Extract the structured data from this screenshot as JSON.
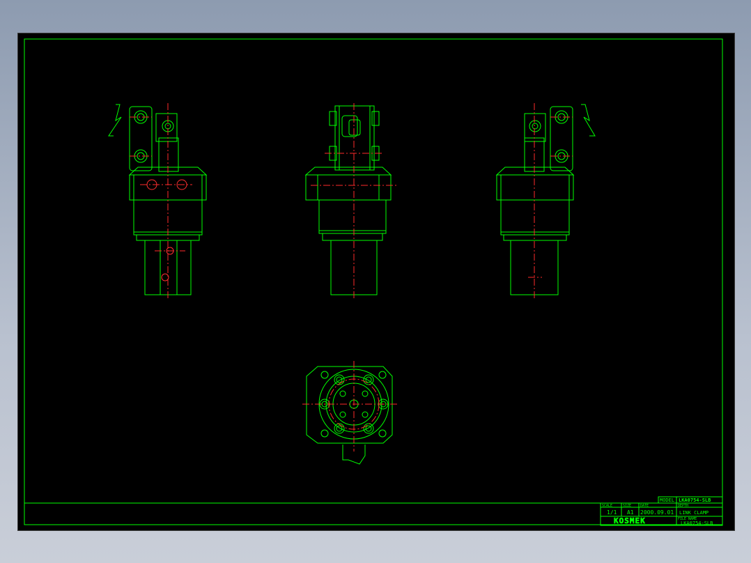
{
  "title_block": {
    "model_label": "MODEL",
    "model_value": "LKA0754-SLB",
    "scale_label": "SCALE",
    "scale_value": "1/1",
    "size_label": "SIZE",
    "size_value": "A1",
    "date_label": "DATE",
    "date_value": "2000.09.01",
    "depth_label": "DEPTH",
    "description": "LINK CLAMP",
    "company": "KOSMEK",
    "file_label": "FILE NAME",
    "file_value": "LKA0754-SLB"
  },
  "colors": {
    "outline": "#00ff00",
    "centerline": "#ff2a2a",
    "background": "#000000",
    "window_bg": "#9aa7ba"
  }
}
